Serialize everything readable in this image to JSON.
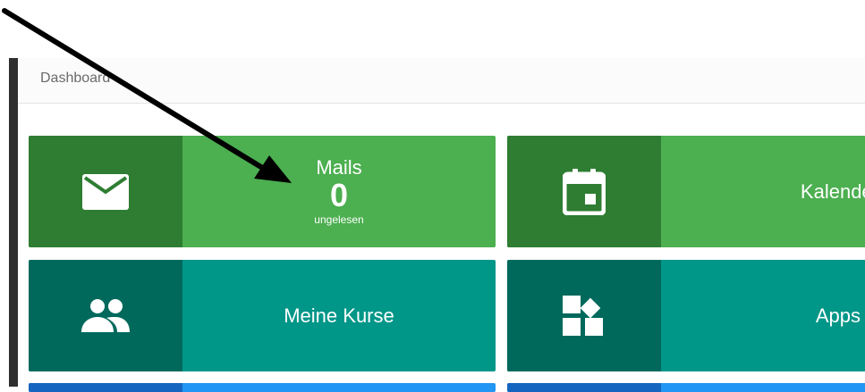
{
  "header": {
    "breadcrumb": "Dashboard"
  },
  "tiles": {
    "mails": {
      "title": "Mails",
      "count": "0",
      "subtitle": "ungelesen",
      "icon": "mail-icon"
    },
    "kalender": {
      "title": "Kalender",
      "icon": "calendar-icon"
    },
    "kurse": {
      "title": "Meine Kurse",
      "icon": "people-icon"
    },
    "apps": {
      "title": "Apps",
      "icon": "apps-icon"
    }
  },
  "colors": {
    "green": "#4caf50",
    "green_dark": "#2e7d32",
    "teal": "#009688",
    "teal_dark": "#00695c",
    "blue": "#2196f3",
    "blue_dark": "#1565c0"
  }
}
